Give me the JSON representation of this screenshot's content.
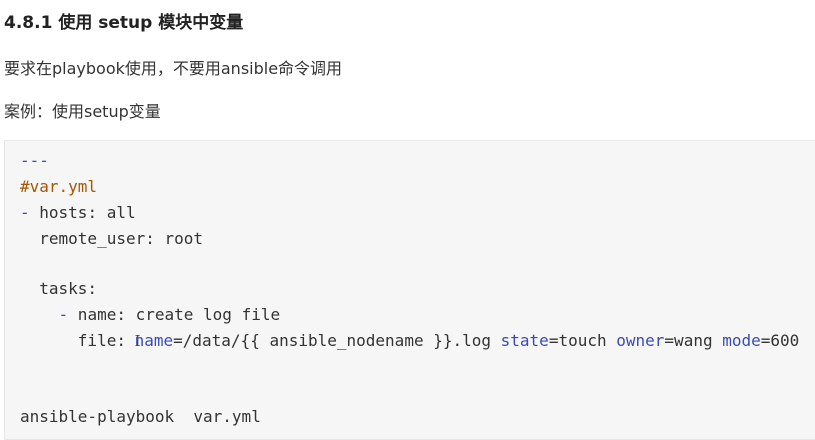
{
  "heading": "4.8.1 使用 setup 模块中变量",
  "paragraphs": {
    "p1": "要求在playbook使用，不要用ansible命令调用",
    "p2": "案例：使用setup变量"
  },
  "code": {
    "line1": "---",
    "line2": "#var.yml",
    "line3_dash": "-",
    "line3_rest": " hosts: all",
    "line4": "  remote_user: root",
    "line6": "  tasks:",
    "line7_indent": "    ",
    "line7_dash": "-",
    "line7_rest": " name: create log file",
    "line8_prefix": "      file: ",
    "cursor": "I",
    "line8_name_key": "name",
    "line8_name_val": "=/data/{{ ansible_nodename }}.log ",
    "line8_state_key": "state",
    "line8_state_val": "=touch ",
    "line8_owner_key": "owner",
    "line8_owner_val": "=wang ",
    "line8_mode_key": "mode",
    "line8_mode_val": "=600",
    "line11": "ansible-playbook  var.yml"
  }
}
